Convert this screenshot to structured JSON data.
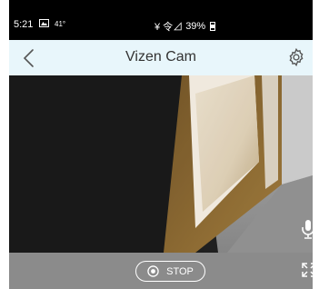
{
  "status_bar": {
    "time": "5:21",
    "temp": "41°",
    "signal": "¥ 令⊿",
    "battery": "39%"
  },
  "app_bar": {
    "title": "Vizen Cam",
    "back_icon": "chevron-left-icon",
    "settings_icon": "gear-icon"
  },
  "controls": {
    "stop_label": "STOP",
    "record_icon": "record-icon",
    "expand_icon": "fullscreen-icon",
    "mic_icon": "microphone-icon"
  },
  "colors": {
    "app_bar_bg": "#e8f6fb",
    "controls_bg": "#8b8b8b",
    "status_bar_bg": "#000000"
  }
}
